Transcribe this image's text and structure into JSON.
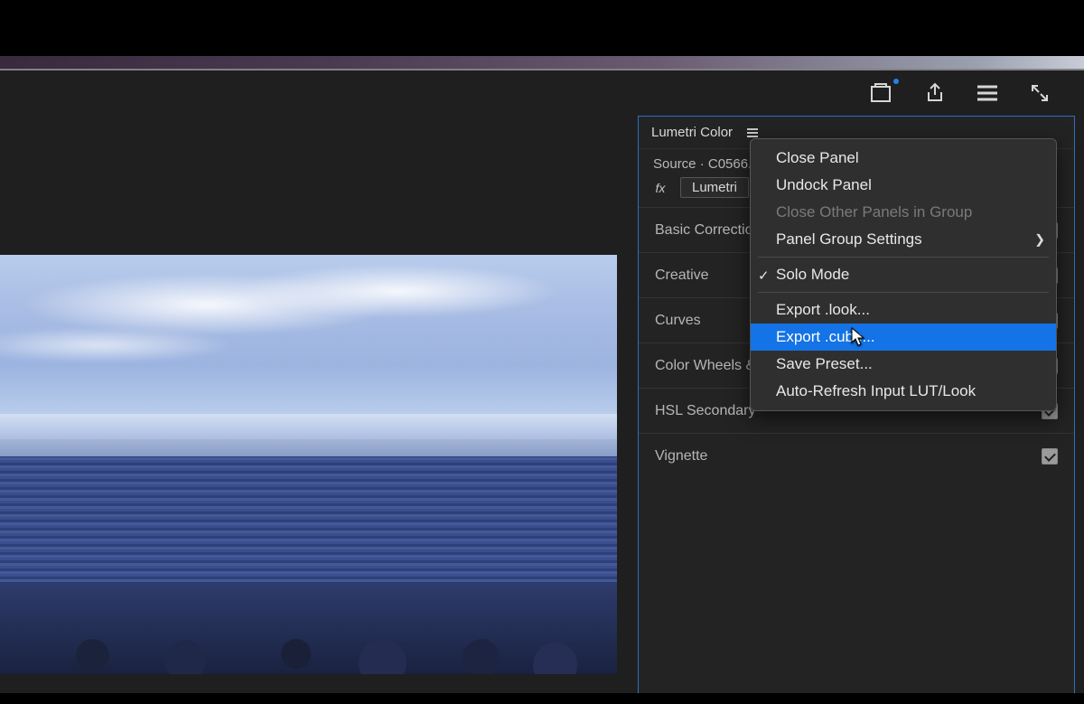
{
  "panel": {
    "title": "Lumetri Color",
    "source_line": "Source · C0566.",
    "fx_label": "fx",
    "fx_button": "Lumetri",
    "sections": [
      {
        "label": "Basic Correction",
        "checked": true
      },
      {
        "label": "Creative",
        "checked": true
      },
      {
        "label": "Curves",
        "checked": true
      },
      {
        "label": "Color Wheels &",
        "checked": true
      },
      {
        "label": "HSL Secondary",
        "checked": true
      },
      {
        "label": "Vignette",
        "checked": true
      }
    ]
  },
  "context_menu": {
    "items": [
      {
        "label": "Close Panel"
      },
      {
        "label": "Undock Panel"
      },
      {
        "label": "Close Other Panels in Group",
        "disabled": true
      },
      {
        "label": "Panel Group Settings",
        "submenu": true
      },
      {
        "sep": true
      },
      {
        "label": "Solo Mode",
        "checked": true
      },
      {
        "sep": true
      },
      {
        "label": "Export .look..."
      },
      {
        "label": "Export .cube...",
        "selected": true
      },
      {
        "label": "Save Preset..."
      },
      {
        "label": "Auto-Refresh Input LUT/Look"
      }
    ]
  },
  "toolbar_icons": {
    "quick_export": "quick-export-icon",
    "share": "share-icon",
    "workspaces": "workspaces-icon",
    "fullscreen": "fullscreen-icon"
  }
}
